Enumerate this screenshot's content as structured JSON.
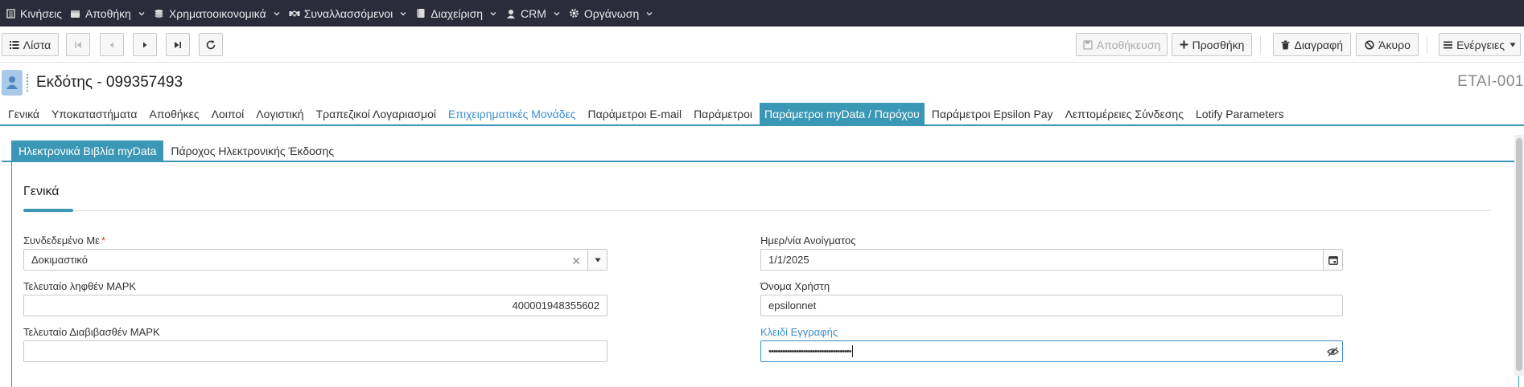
{
  "topnav": {
    "items": [
      {
        "label": "Κινήσεις",
        "icon": "list-icon"
      },
      {
        "label": "Αποθήκη",
        "icon": "box-icon"
      },
      {
        "label": "Χρηματοοικονομικά",
        "icon": "coins-icon"
      },
      {
        "label": "Συναλλασσόμενοι",
        "icon": "handshake-icon"
      },
      {
        "label": "Διαχείριση",
        "icon": "book-icon"
      },
      {
        "label": "CRM",
        "icon": "user-icon"
      },
      {
        "label": "Οργάνωση",
        "icon": "gear-icon"
      }
    ]
  },
  "toolbar": {
    "list_label": "Λίστα",
    "save_label": "Αποθήκευση",
    "add_label": "Προσθήκη",
    "delete_label": "Διαγραφή",
    "cancel_label": "Άκυρο",
    "actions_label": "Ενέργειες"
  },
  "record": {
    "title": "Εκδότης - 099357493",
    "code": "ETAI-001"
  },
  "tabs": [
    {
      "label": "Γενικά"
    },
    {
      "label": "Υποκαταστήματα"
    },
    {
      "label": "Αποθήκες"
    },
    {
      "label": "Λοιποί"
    },
    {
      "label": "Λογιστική"
    },
    {
      "label": "Τραπεζικοί Λογαριασμοί"
    },
    {
      "label": "Επιχειρηματικές Μονάδες"
    },
    {
      "label": "Παράμετροι E-mail"
    },
    {
      "label": "Παράμετροι"
    },
    {
      "label": "Παράμετροι myData / Παρόχου"
    },
    {
      "label": "Παράμετροι Epsilon Pay"
    },
    {
      "label": "Λεπτομέρειες Σύνδεσης"
    },
    {
      "label": "Lotify Parameters"
    }
  ],
  "subtabs": [
    {
      "label": "Ηλεκτρονικά Βιβλία myData"
    },
    {
      "label": "Πάροχος Ηλεκτρονικής Έκδοσης"
    }
  ],
  "section": {
    "title": "Γενικά"
  },
  "form": {
    "linked_with": {
      "label": "Συνδεδεμένο Με",
      "required_mark": "*",
      "value": "Δοκιμαστικό"
    },
    "last_received_mark": {
      "label": "Τελευταίο ληφθέν ΜΑΡΚ",
      "value": "400001948355602"
    },
    "last_read_mark": {
      "label": "Τελευταίο Διαβιβασθέν ΜΑΡΚ",
      "value": ""
    },
    "opening_date": {
      "label": "Ημερ/νία Ανοίγματος",
      "value": "1/1/2025"
    },
    "username": {
      "label": "Όνομα Χρήστη",
      "value": "epsilonnet"
    },
    "registration_key": {
      "label": "Κλειδί Εγγραφής",
      "value": "••••••••••••••••••••••••••••••••••••"
    }
  },
  "colors": {
    "nav_bg": "#2b2b3b",
    "accent": "#3a97b5",
    "link_blue": "#3d8fd0",
    "required": "#e03030"
  }
}
